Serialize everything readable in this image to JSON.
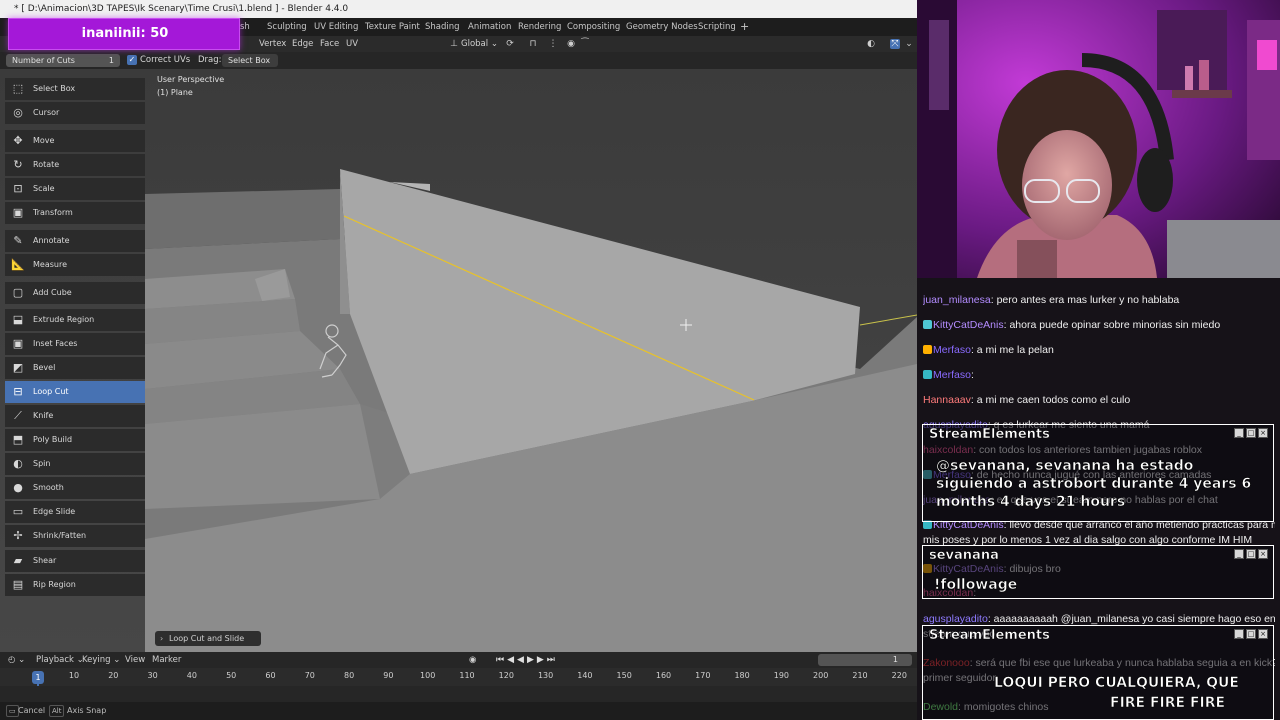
{
  "window": {
    "title": "* [ D:\\Animacion\\3D TAPES\\Ik Scenary\\Time Crusi\\1.blend ] - Blender 4.4.0"
  },
  "alert": {
    "text": "inaniinii: 50"
  },
  "workspace_tabs": [
    "sh",
    "Sculpting",
    "UV Editing",
    "Texture Paint",
    "Shading",
    "Animation",
    "Rendering",
    "Compositing",
    "Geometry Nodes",
    "Scripting",
    "+"
  ],
  "header": {
    "menus": [
      "Vertex",
      "Edge",
      "Face",
      "UV"
    ],
    "orientation": "Global"
  },
  "tool_settings": {
    "cuts_label": "Number of Cuts",
    "cuts_value": "1",
    "correct_uvs_label": "Correct UVs",
    "correct_uvs_checked": true,
    "drag_label": "Drag:",
    "drag_value": "Select Box"
  },
  "viewport": {
    "perspective": "User Perspective",
    "object": "(1) Plane"
  },
  "toolbar": [
    {
      "label": "Select Box",
      "icon": "select-box-icon",
      "glyph": "⬚"
    },
    {
      "label": "Cursor",
      "icon": "cursor-icon",
      "glyph": "◎"
    },
    {
      "label": "Move",
      "icon": "move-icon",
      "glyph": "✥"
    },
    {
      "label": "Rotate",
      "icon": "rotate-icon",
      "glyph": "↻"
    },
    {
      "label": "Scale",
      "icon": "scale-icon",
      "glyph": "⊡"
    },
    {
      "label": "Transform",
      "icon": "transform-icon",
      "glyph": "▣"
    },
    {
      "label": "Annotate",
      "icon": "annotate-icon",
      "glyph": "✎"
    },
    {
      "label": "Measure",
      "icon": "measure-icon",
      "glyph": "📐"
    },
    {
      "label": "Add Cube",
      "icon": "add-cube-icon",
      "glyph": "▢"
    },
    {
      "label": "Extrude Region",
      "icon": "extrude-region-icon",
      "glyph": "⬓"
    },
    {
      "label": "Inset Faces",
      "icon": "inset-faces-icon",
      "glyph": "▣"
    },
    {
      "label": "Bevel",
      "icon": "bevel-icon",
      "glyph": "◩"
    },
    {
      "label": "Loop Cut",
      "icon": "loop-cut-icon",
      "glyph": "⊟"
    },
    {
      "label": "Knife",
      "icon": "knife-icon",
      "glyph": "⟋"
    },
    {
      "label": "Poly Build",
      "icon": "poly-build-icon",
      "glyph": "⬒"
    },
    {
      "label": "Spin",
      "icon": "spin-icon",
      "glyph": "◐"
    },
    {
      "label": "Smooth",
      "icon": "smooth-icon",
      "glyph": "●"
    },
    {
      "label": "Edge Slide",
      "icon": "edge-slide-icon",
      "glyph": "▭"
    },
    {
      "label": "Shrink/Fatten",
      "icon": "shrink-fatten-icon",
      "glyph": "✢"
    },
    {
      "label": "Shear",
      "icon": "shear-icon",
      "glyph": "▰"
    },
    {
      "label": "Rip Region",
      "icon": "rip-region-icon",
      "glyph": "▤"
    }
  ],
  "active_tool": "Loop Cut",
  "redo_panel": {
    "label": "Loop Cut and Slide"
  },
  "timeline": {
    "menus": [
      "Playback",
      "Keying",
      "View",
      "Marker"
    ],
    "current_frame": "1",
    "ticks": [
      "1",
      "10",
      "20",
      "30",
      "40",
      "50",
      "60",
      "70",
      "80",
      "90",
      "100",
      "110",
      "120",
      "130",
      "140",
      "150",
      "160",
      "170",
      "180",
      "190",
      "200",
      "210",
      "220"
    ]
  },
  "status": {
    "cancel": "Cancel",
    "alt_key": "Alt",
    "axis_snap": "Axis Snap"
  },
  "chat": {
    "messages": [
      {
        "user": "juan_milanesa",
        "color": "#b38cff",
        "text": "pero antes era mas lurker y no hablaba"
      },
      {
        "user": "KittyCatDeAnis",
        "color": "#b48cff",
        "text": "ahora puede opinar sobre minorias sin miedo"
      },
      {
        "user": "Merfaso",
        "color": "#8a6bff",
        "text": "a mi me la pelan"
      },
      {
        "user": "Merfaso",
        "color": "#8a6bff",
        "text": ""
      },
      {
        "user": "Hannaaav",
        "color": "#ff7b7b",
        "text": "a mi me caen todos como el culo"
      },
      {
        "user": "agusplayadito",
        "color": "#8f7bff",
        "text": "q es lurkear me siento una mamá"
      },
      {
        "user": "haixcoldan",
        "color": "#ff5c9a",
        "text": "con todos los anteriores tambien jugabas roblox"
      },
      {
        "user": "Merfaso",
        "color": "#8a6bff",
        "text": "de hecho nunca jugué con las anteriores camadas"
      },
      {
        "user": "juan_milanesa",
        "color": "#b38cff",
        "text": "es que ves el stream pero no hablas por el chat"
      },
      {
        "user": "KittyCatDeAnis",
        "color": "#b48cff",
        "text": "llevo desde que arranco el año metiendo practicas para mejorar"
      },
      {
        "user": "",
        "color": "#efefef",
        "text": "mis poses y por lo menos 1 vez al dia salgo con algo conforme IM HIM"
      },
      {
        "user": "KittyCatDeAnis",
        "color": "#b48cff",
        "text": "dibujos bro"
      },
      {
        "user": "haixcoldan",
        "color": "#ff5c9a",
        "text": ""
      },
      {
        "user": "agusplayadito",
        "color": "#8f7bff",
        "text": "aaaaaaaaaah @juan_milanesa yo casi siempre hago eso en cualquier"
      },
      {
        "user": "",
        "color": "#efefef",
        "text": "stream que veo"
      },
      {
        "user": "Zakonooo",
        "color": "#ff4040",
        "text": "será que fbi ese que lurkeaba y nunca hablaba seguia a en kick? tu"
      },
      {
        "user": "",
        "color": "#efefef",
        "text": "primer seguidor"
      },
      {
        "user": "Dewold",
        "color": "#7cff7c",
        "text": "momigotes chinos"
      }
    ]
  },
  "overlays": {
    "se_title": "StreamElements",
    "follow_alert": "@sevanana, sevanana ha estado siguiendo a astrobort durante 4 years 6 months 4 days 21 hours",
    "follow_user": "sevanana",
    "followage_cmd": "!followage",
    "tts_line1": "LOQUI PERO CUALQUIERA, QUE",
    "tts_line2": "FIRE FIRE FIRE"
  },
  "colors": {
    "accent": "#4772b3",
    "alert": "#a418d8",
    "selection_edge": "#e8c22a"
  }
}
